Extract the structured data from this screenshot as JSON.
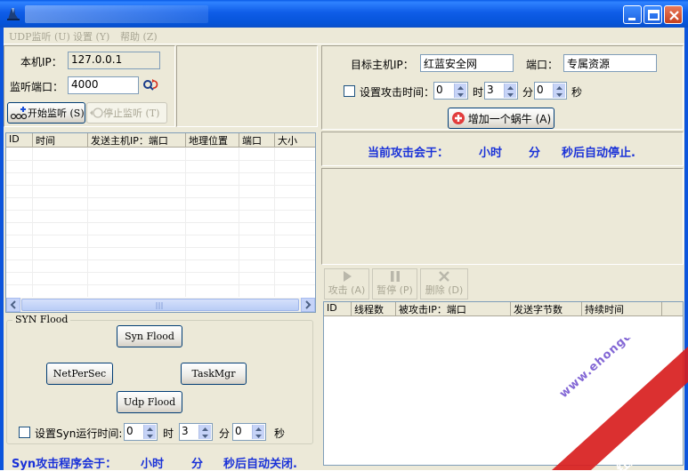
{
  "window": {
    "title": ""
  },
  "menu": [
    {
      "label": "UDP监听 (U)"
    },
    {
      "label": "设置 (Y)"
    },
    {
      "label": "帮助 (Z)"
    }
  ],
  "local": {
    "ip_label": "本机IP：",
    "ip_value": "127.0.0.1",
    "port_label": "监听端口：",
    "port_value": "4000",
    "start_label": "开始监听 (S)",
    "stop_label": "停止监听 (T)"
  },
  "recv_table": {
    "columns": [
      "ID",
      "时间",
      "发送主机IP：端口",
      "地理位置",
      "端口",
      "大小"
    ]
  },
  "target": {
    "ip_label": "目标主机IP：",
    "ip_value": "红蓝安全网",
    "port_label": "端口：",
    "port_value": "专属资源",
    "set_time_label": "设置攻击时间：",
    "hours": "0",
    "hours_unit": "时",
    "minutes": "3",
    "minutes_unit": "分",
    "seconds": "0",
    "seconds_unit": "秒",
    "add_label": "增加一个蜗牛 (A)"
  },
  "attack_status": {
    "prefix": "当前攻击会于：",
    "hours_unit": "小时",
    "minutes_unit": "分",
    "suffix": "秒后自动停止."
  },
  "toolbar": {
    "attack_label": "攻击 (A)",
    "pause_label": "暂停 (P)",
    "delete_label": "删除 (D)"
  },
  "attack_table": {
    "columns": [
      "ID",
      "线程数",
      "被攻击IP：端口",
      "发送字节数",
      "持续时间"
    ]
  },
  "syn": {
    "group_label": "SYN Flood",
    "syn_flood_label": "Syn Flood",
    "netpersec_label": "NetPerSec",
    "taskmgr_label": "TaskMgr",
    "udp_flood_label": "Udp Flood",
    "set_time_label": "设置Syn运行时间:",
    "hours": "0",
    "hours_unit": "时",
    "minutes": "3",
    "minutes_unit": "分",
    "seconds": "0",
    "seconds_unit": "秒",
    "status_prefix": "Syn攻击程序会于：",
    "status_hours": "小时",
    "status_minutes": "分",
    "status_suffix": "秒后自动关闭."
  },
  "watermark": {
    "url": "www.ehongdun.com",
    "brand": "红蓝安全网"
  },
  "colors": {
    "titlebar": "#0553d8",
    "face": "#ece9d8",
    "status_blue": "#1a32d8",
    "watermark_red": "#d81e1e"
  }
}
